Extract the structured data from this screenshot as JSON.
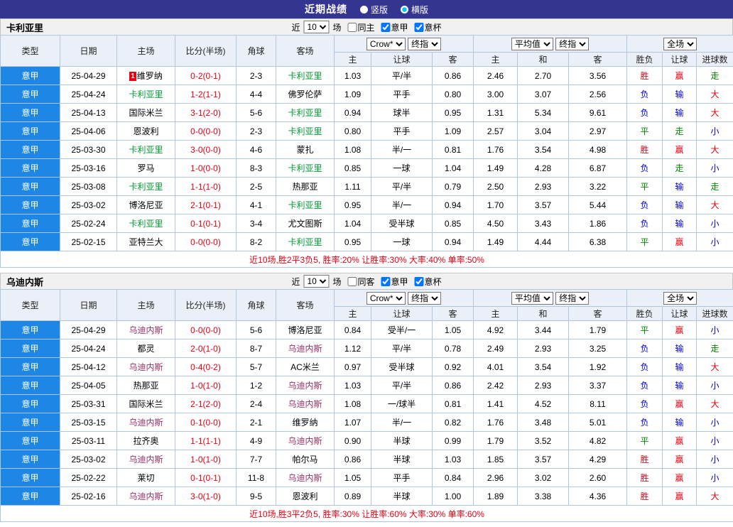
{
  "topbar": {
    "title": "近期战绩",
    "radios": [
      {
        "label": "竖版",
        "selected": false
      },
      {
        "label": "横版",
        "selected": true
      }
    ]
  },
  "legend_colors": {
    "win": "#e60012",
    "lose": "#0000cc",
    "draw": "#008800"
  },
  "result_color_map": {
    "胜": "win",
    "赢": "win",
    "大": "win",
    "负": "lose",
    "输": "lose",
    "小": "lose",
    "平": "draw",
    "走": "draw"
  },
  "sections": [
    {
      "team": "卡利亚里",
      "team_color": "#009933",
      "filter": {
        "prefix": "近",
        "games": "10",
        "suffix": "场",
        "checks": [
          {
            "label": "同主",
            "checked": false
          },
          {
            "label": "意甲",
            "checked": true
          },
          {
            "label": "意杯",
            "checked": true
          }
        ]
      },
      "selects": [
        "Crow*",
        "终指",
        "平均值",
        "终指",
        "全场"
      ],
      "columns": [
        "类型",
        "日期",
        "主场",
        "比分(半场)",
        "角球",
        "客场"
      ],
      "sub_columns": [
        "主",
        "让球",
        "客",
        "主",
        "和",
        "客",
        "胜负",
        "让球",
        "进球数"
      ],
      "rows": [
        {
          "league": "意甲",
          "date": "25-04-29",
          "home": "维罗纳",
          "home_badge": "1",
          "home_team": false,
          "score": "0-2(0-1)",
          "corners": "2-3",
          "away": "卡利亚里",
          "away_team": true,
          "odds": [
            "1.03",
            "平/半",
            "0.86",
            "2.46",
            "2.70",
            "3.56"
          ],
          "results": [
            "胜",
            "赢",
            "走"
          ]
        },
        {
          "league": "意甲",
          "date": "25-04-24",
          "home": "卡利亚里",
          "home_team": true,
          "score": "1-2(1-1)",
          "corners": "4-4",
          "away": "佛罗伦萨",
          "away_team": false,
          "odds": [
            "1.09",
            "平手",
            "0.80",
            "3.00",
            "3.07",
            "2.56"
          ],
          "results": [
            "负",
            "输",
            "大"
          ]
        },
        {
          "league": "意甲",
          "date": "25-04-13",
          "home": "国际米兰",
          "home_team": false,
          "score": "3-1(2-0)",
          "corners": "5-6",
          "away": "卡利亚里",
          "away_team": true,
          "odds": [
            "0.94",
            "球半",
            "0.95",
            "1.31",
            "5.34",
            "9.61"
          ],
          "results": [
            "负",
            "输",
            "大"
          ]
        },
        {
          "league": "意甲",
          "date": "25-04-06",
          "home": "恩波利",
          "home_team": false,
          "score": "0-0(0-0)",
          "corners": "2-3",
          "away": "卡利亚里",
          "away_team": true,
          "odds": [
            "0.80",
            "平手",
            "1.09",
            "2.57",
            "3.04",
            "2.97"
          ],
          "results": [
            "平",
            "走",
            "小"
          ]
        },
        {
          "league": "意甲",
          "date": "25-03-30",
          "home": "卡利亚里",
          "home_team": true,
          "score": "3-0(0-0)",
          "corners": "4-6",
          "away": "蒙扎",
          "away_team": false,
          "odds": [
            "1.08",
            "半/一",
            "0.81",
            "1.76",
            "3.54",
            "4.98"
          ],
          "results": [
            "胜",
            "赢",
            "大"
          ]
        },
        {
          "league": "意甲",
          "date": "25-03-16",
          "home": "罗马",
          "home_team": false,
          "score": "1-0(0-0)",
          "corners": "8-3",
          "away": "卡利亚里",
          "away_team": true,
          "odds": [
            "0.85",
            "一球",
            "1.04",
            "1.49",
            "4.28",
            "6.87"
          ],
          "results": [
            "负",
            "走",
            "小"
          ]
        },
        {
          "league": "意甲",
          "date": "25-03-08",
          "home": "卡利亚里",
          "home_team": true,
          "score": "1-1(1-0)",
          "corners": "2-5",
          "away": "热那亚",
          "away_team": false,
          "odds": [
            "1.11",
            "平/半",
            "0.79",
            "2.50",
            "2.93",
            "3.22"
          ],
          "results": [
            "平",
            "输",
            "走"
          ]
        },
        {
          "league": "意甲",
          "date": "25-03-02",
          "home": "博洛尼亚",
          "home_team": false,
          "score": "2-1(0-1)",
          "corners": "4-1",
          "away": "卡利亚里",
          "away_team": true,
          "odds": [
            "0.95",
            "半/一",
            "0.94",
            "1.70",
            "3.57",
            "5.44"
          ],
          "results": [
            "负",
            "输",
            "大"
          ]
        },
        {
          "league": "意甲",
          "date": "25-02-24",
          "home": "卡利亚里",
          "home_team": true,
          "score": "0-1(0-1)",
          "corners": "3-4",
          "away": "尤文图斯",
          "away_team": false,
          "odds": [
            "1.04",
            "受半球",
            "0.85",
            "4.50",
            "3.43",
            "1.86"
          ],
          "results": [
            "负",
            "输",
            "小"
          ]
        },
        {
          "league": "意甲",
          "date": "25-02-15",
          "home": "亚特兰大",
          "home_team": false,
          "score": "0-0(0-0)",
          "corners": "8-2",
          "away": "卡利亚里",
          "away_team": true,
          "odds": [
            "0.95",
            "一球",
            "0.94",
            "1.49",
            "4.44",
            "6.38"
          ],
          "results": [
            "平",
            "赢",
            "小"
          ]
        }
      ],
      "summary": "近10场,胜2平3负5, 胜率:20% 让胜率:30% 大率:40% 单率:50%"
    },
    {
      "team": "乌迪内斯",
      "team_color": "#993366",
      "filter": {
        "prefix": "近",
        "games": "10",
        "suffix": "场",
        "checks": [
          {
            "label": "同客",
            "checked": false
          },
          {
            "label": "意甲",
            "checked": true
          },
          {
            "label": "意杯",
            "checked": true
          }
        ]
      },
      "selects": [
        "Crow*",
        "终指",
        "平均值",
        "终指",
        "全场"
      ],
      "columns": [
        "类型",
        "日期",
        "主场",
        "比分(半场)",
        "角球",
        "客场"
      ],
      "sub_columns": [
        "主",
        "让球",
        "客",
        "主",
        "和",
        "客",
        "胜负",
        "让球",
        "进球数"
      ],
      "rows": [
        {
          "league": "意甲",
          "date": "25-04-29",
          "home": "乌迪内斯",
          "home_team": true,
          "score": "0-0(0-0)",
          "corners": "5-6",
          "away": "博洛尼亚",
          "away_team": false,
          "odds": [
            "0.84",
            "受半/一",
            "1.05",
            "4.92",
            "3.44",
            "1.79"
          ],
          "results": [
            "平",
            "赢",
            "小"
          ]
        },
        {
          "league": "意甲",
          "date": "25-04-24",
          "home": "都灵",
          "home_team": false,
          "score": "2-0(1-0)",
          "corners": "8-7",
          "away": "乌迪内斯",
          "away_team": true,
          "odds": [
            "1.12",
            "平/半",
            "0.78",
            "2.49",
            "2.93",
            "3.25"
          ],
          "results": [
            "负",
            "输",
            "走"
          ]
        },
        {
          "league": "意甲",
          "date": "25-04-12",
          "home": "乌迪内斯",
          "home_team": true,
          "score": "0-4(0-2)",
          "corners": "5-7",
          "away": "AC米兰",
          "away_team": false,
          "odds": [
            "0.97",
            "受半球",
            "0.92",
            "4.01",
            "3.54",
            "1.92"
          ],
          "results": [
            "负",
            "输",
            "大"
          ]
        },
        {
          "league": "意甲",
          "date": "25-04-05",
          "home": "热那亚",
          "home_team": false,
          "score": "1-0(1-0)",
          "corners": "1-2",
          "away": "乌迪内斯",
          "away_team": true,
          "odds": [
            "1.03",
            "平/半",
            "0.86",
            "2.42",
            "2.93",
            "3.37"
          ],
          "results": [
            "负",
            "输",
            "小"
          ]
        },
        {
          "league": "意甲",
          "date": "25-03-31",
          "home": "国际米兰",
          "home_team": false,
          "score": "2-1(2-0)",
          "corners": "2-4",
          "away": "乌迪内斯",
          "away_team": true,
          "odds": [
            "1.08",
            "一/球半",
            "0.81",
            "1.41",
            "4.52",
            "8.11"
          ],
          "results": [
            "负",
            "赢",
            "大"
          ]
        },
        {
          "league": "意甲",
          "date": "25-03-15",
          "home": "乌迪内斯",
          "home_team": true,
          "score": "0-1(0-0)",
          "corners": "2-1",
          "away": "维罗纳",
          "away_team": false,
          "odds": [
            "1.07",
            "半/一",
            "0.82",
            "1.76",
            "3.48",
            "5.01"
          ],
          "results": [
            "负",
            "输",
            "小"
          ]
        },
        {
          "league": "意甲",
          "date": "25-03-11",
          "home": "拉齐奥",
          "home_team": false,
          "score": "1-1(1-1)",
          "corners": "4-9",
          "away": "乌迪内斯",
          "away_team": true,
          "odds": [
            "0.90",
            "半球",
            "0.99",
            "1.79",
            "3.52",
            "4.82"
          ],
          "results": [
            "平",
            "赢",
            "小"
          ]
        },
        {
          "league": "意甲",
          "date": "25-03-02",
          "home": "乌迪内斯",
          "home_team": true,
          "score": "1-0(1-0)",
          "corners": "7-7",
          "away": "帕尔马",
          "away_team": false,
          "odds": [
            "0.86",
            "半球",
            "1.03",
            "1.85",
            "3.57",
            "4.29"
          ],
          "results": [
            "胜",
            "赢",
            "小"
          ]
        },
        {
          "league": "意甲",
          "date": "25-02-22",
          "home": "莱切",
          "home_team": false,
          "score": "0-1(0-1)",
          "corners": "11-8",
          "away": "乌迪内斯",
          "away_team": true,
          "odds": [
            "1.05",
            "平手",
            "0.84",
            "2.96",
            "3.02",
            "2.60"
          ],
          "results": [
            "胜",
            "赢",
            "小"
          ]
        },
        {
          "league": "意甲",
          "date": "25-02-16",
          "home": "乌迪内斯",
          "home_team": true,
          "score": "3-0(1-0)",
          "corners": "9-5",
          "away": "恩波利",
          "away_team": false,
          "odds": [
            "0.89",
            "半球",
            "1.00",
            "1.89",
            "3.38",
            "4.36"
          ],
          "results": [
            "胜",
            "赢",
            "大"
          ]
        }
      ],
      "summary": "近10场,胜3平2负5, 胜率:30% 让胜率:60% 大率:30% 单率:60%"
    }
  ]
}
